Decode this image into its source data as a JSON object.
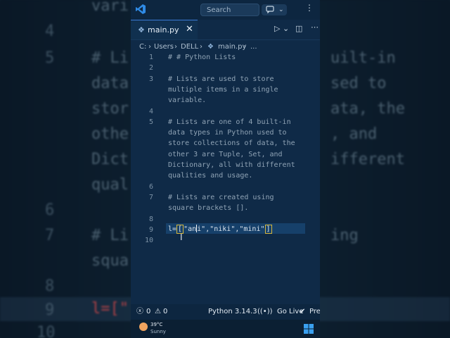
{
  "app": {
    "search_placeholder": "Search"
  },
  "tab": {
    "label": "main.py",
    "close_glyph": "✕"
  },
  "breadcrumb": {
    "drive": "C:",
    "folder1": "Users",
    "folder2": "DELL",
    "file": "main.py",
    "ellipsis": "..."
  },
  "editor": {
    "lines": [
      {
        "n": "1",
        "text": "# # Python Lists"
      },
      {
        "n": "2",
        "text": ""
      },
      {
        "n": "3",
        "text": "# Lists are used to store"
      },
      {
        "n": "",
        "text": "multiple items in a single"
      },
      {
        "n": "",
        "text": "variable."
      },
      {
        "n": "4",
        "text": ""
      },
      {
        "n": "5",
        "text": "# Lists are one of 4 built-in"
      },
      {
        "n": "",
        "text": "data types in Python used to"
      },
      {
        "n": "",
        "text": "store collections of data, the"
      },
      {
        "n": "",
        "text": "other 3 are Tuple, Set, and"
      },
      {
        "n": "",
        "text": "Dictionary, all with different"
      },
      {
        "n": "",
        "text": "qualities and usage."
      },
      {
        "n": "6",
        "text": ""
      },
      {
        "n": "7",
        "text": "# Lists are created using"
      },
      {
        "n": "",
        "text": "square brackets []."
      },
      {
        "n": "8",
        "text": ""
      },
      {
        "n": "9",
        "text": ""
      },
      {
        "n": "10",
        "text": ""
      }
    ],
    "line9": {
      "prefix": "l=",
      "open_bracket": "[",
      "str1_a": "\"an",
      "str1_b": "i\"",
      "comma1": ",",
      "str2": "\"niki\"",
      "comma2": ",",
      "str3": "\"mini\"",
      "close_bracket": "]"
    }
  },
  "statusbar": {
    "errors": "0",
    "warnings": "0",
    "language": "Python 3.14.3",
    "go_live": "Go Live",
    "prettier": "Pre"
  },
  "taskbar": {
    "temperature": "39°C",
    "condition": "Sunny"
  },
  "background": {
    "nums": [
      "4",
      "5",
      "6",
      "7",
      "8",
      "9",
      "10"
    ],
    "left_texts": [
      "vari",
      "# Li",
      "data",
      "stor",
      "othe",
      "Dict",
      "qual",
      "# Li",
      "squa"
    ],
    "right_texts": [
      "uilt-in",
      "sed to",
      "ata, the",
      ", and",
      "ifferent",
      "ing"
    ]
  },
  "colors": {
    "accent": "#3a7bd5",
    "editor_bg": "#0f2a47",
    "statusbar_bg": "#0d2640",
    "bracket_highlight": "#d7b63a"
  }
}
